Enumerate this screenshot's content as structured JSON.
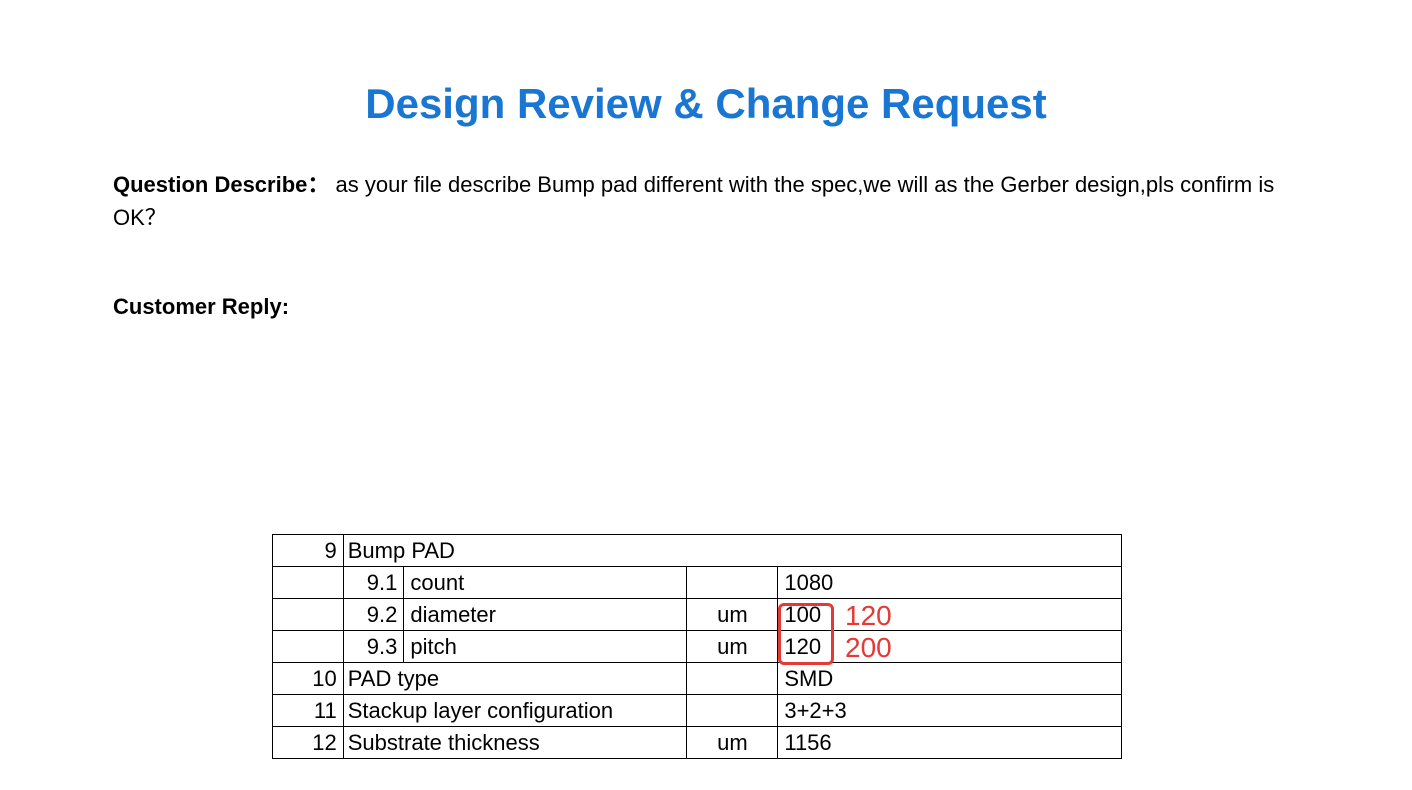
{
  "title": "Design Review & Change Request",
  "question": {
    "label": "Question Describe：",
    "text": "as your file describe Bump pad different with the spec,we will as the Gerber design,pls confirm is OK？"
  },
  "reply": {
    "label": "Customer Reply:"
  },
  "table": {
    "rows": [
      {
        "num": "9",
        "sub": "",
        "name": "Bump PAD",
        "unit": "",
        "value": ""
      },
      {
        "num": "",
        "sub": "9.1",
        "name": "count",
        "unit": "",
        "value": "1080"
      },
      {
        "num": "",
        "sub": "9.2",
        "name": "diameter",
        "unit": "um",
        "value": "100"
      },
      {
        "num": "",
        "sub": "9.3",
        "name": "pitch",
        "unit": "um",
        "value": "120"
      },
      {
        "num": "10",
        "sub": "",
        "name": "PAD type",
        "unit": "",
        "value": "SMD"
      },
      {
        "num": "11",
        "sub": "",
        "name": "Stackup layer configuration",
        "unit": "",
        "value": "3+2+3"
      },
      {
        "num": "12",
        "sub": "",
        "name": "Substrate thickness",
        "unit": "um",
        "value": "1156"
      }
    ]
  },
  "annotations": {
    "diameter_new": "120",
    "pitch_new": "200"
  }
}
